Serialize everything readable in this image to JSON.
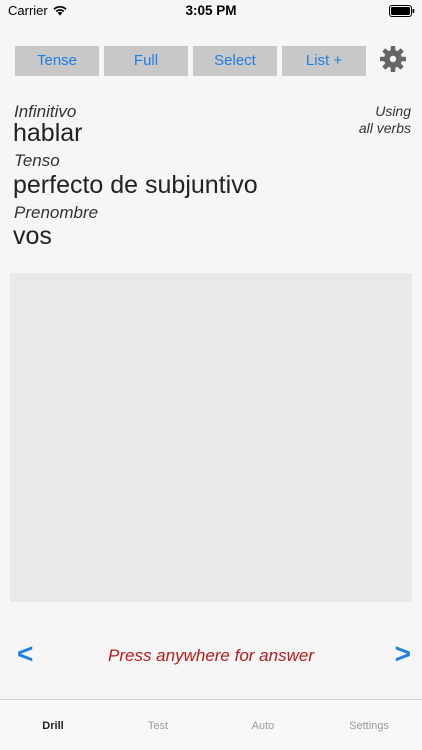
{
  "status_bar": {
    "carrier": "Carrier",
    "time": "3:05 PM"
  },
  "toolbar": {
    "buttons": [
      {
        "label": "Tense"
      },
      {
        "label": "Full"
      },
      {
        "label": "Select"
      },
      {
        "label": "List +"
      }
    ]
  },
  "info": {
    "infinitive_label": "Infinitivo",
    "infinitive_value": "hablar",
    "tense_label": "Tenso",
    "tense_value": "perfecto de subjuntivo",
    "pronoun_label": "Prenombre",
    "pronoun_value": "vos",
    "using_line1": "Using",
    "using_line2": "all verbs"
  },
  "prompt": {
    "text": "Press anywhere for answer",
    "prev": "<",
    "next": ">"
  },
  "tabs": [
    {
      "label": "Drill",
      "active": true
    },
    {
      "label": "Test",
      "active": false
    },
    {
      "label": "Auto",
      "active": false
    },
    {
      "label": "Settings",
      "active": false
    }
  ],
  "colors": {
    "accent": "#1f7fe0",
    "prompt": "#b81a1a",
    "button_bg": "#c8c8c8"
  }
}
